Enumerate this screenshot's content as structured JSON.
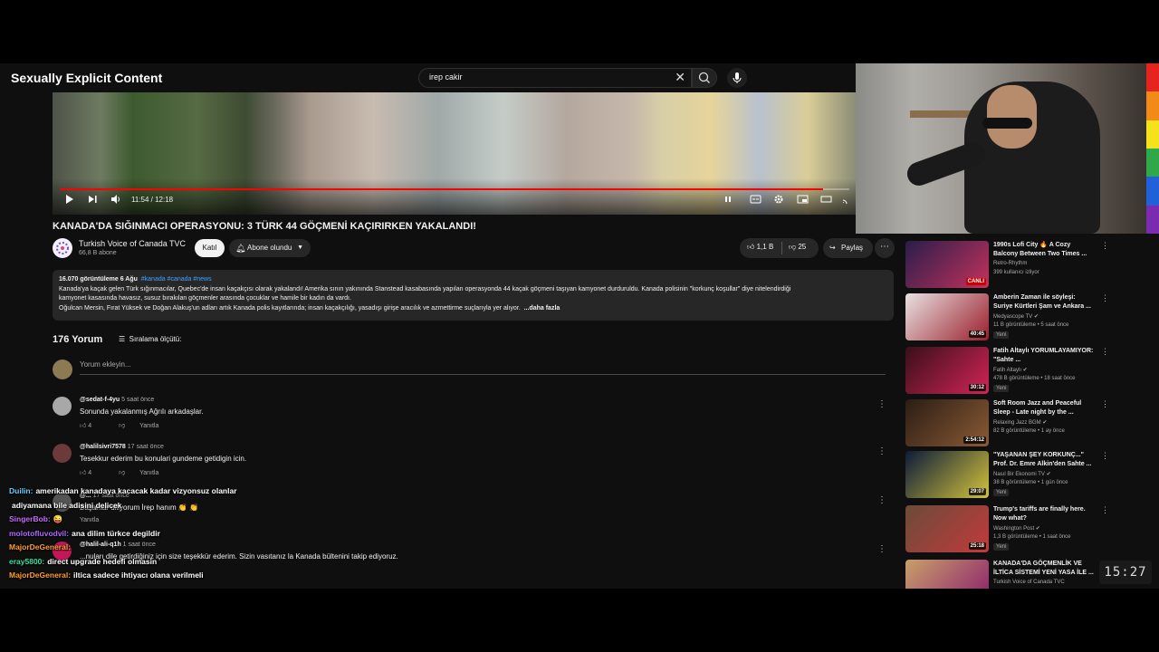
{
  "header": {
    "overlay_title": "Sexually Explicit Content",
    "search_value": "irep cakir"
  },
  "player": {
    "time": "11:54 / 12:18",
    "progress_fraction": 0.967
  },
  "video": {
    "title": "KANADA'DA SIĞINMACI OPERASYONU: 3 TÜRK 44 GÖÇMENİ KAÇIRIRKEN YAKALANDI!",
    "channel_name": "Turkish Voice of Canada TVC",
    "channel_subs": "66,8 B abone",
    "join_label": "Katıl",
    "subscribe_label": "Abone olundu",
    "like_count": "1,1 B",
    "dislike_count": "25",
    "share_label": "Paylaş"
  },
  "description": {
    "meta": "16.070 görüntüleme  6 Ağu",
    "tags": "#kanada #canada #news",
    "line1": "Kanada'ya kaçak gelen Türk sığınmacılar, Quebec'de insan kaçakçısı olarak yakalandı! Amerika sınırı yakınında Stanstead kasabasında yapılan operasyonda 44 kaçak göçmeni taşıyan kamyonet durduruldu. Kanada polisinin \"korkunç koşullar\" diye nitelendirdiği",
    "line2": "kamyonet kasasında havasız, susuz bırakılan göçmenler arasında çocuklar ve hamile bir kadın da vardı.",
    "line3": "Oğulcan Mersin, Fırat Yüksek ve Doğan Alakuş'un adları artık Kanada polis kayıtlarında; insan kaçakçılığı, yasadışı girişe aracılık ve azmettirme suçlarıyla yer alıyor.",
    "more": "...daha fazla"
  },
  "comments": {
    "count_label": "176 Yorum",
    "sort_label": "Sıralama ölçütü:",
    "input_placeholder": "Yorum ekleyin...",
    "items": [
      {
        "author": "@sedat-f-4yu",
        "time": "5 saat önce",
        "text": "Sonunda yakalanmış Ağrılı arkadaşlar.",
        "likes": "4",
        "reply": "Yanıtla"
      },
      {
        "author": "@halilsivri7578",
        "time": "17 saat önce",
        "text": "Tesekkur ederim bu konulari gundeme getidigin icin.",
        "likes": "4",
        "reply": "Yanıtla"
      },
      {
        "author": "@...",
        "time": "17 saat önce",
        "text": "Başarılar diliyorum İrep hanım 👏 👏",
        "likes": "",
        "reply": "Yanıtla"
      },
      {
        "author": "@halil-ali-q1h",
        "time": "1 saat önce",
        "text": "...nuları dile getirdiğiniz için size teşekkür ederim. Sizin vasıtanız la Kanada bültenini takip ediyoruz.",
        "likes": "",
        "reply": ""
      }
    ]
  },
  "recommended": [
    {
      "title": "1990s Lofi City 🔥 A Cozy Balcony Between Two Times ...",
      "channel": "Retro-Rhythm",
      "stats": "399 kullanıcı izliyor",
      "duration": "CANLI",
      "badge": "",
      "colors": [
        "#2a1d4a",
        "#c2325c"
      ]
    },
    {
      "title": "Amberin Zaman ile söyleşi: Suriye Kürtleri Şam ve Ankara ...",
      "channel": "Medyascope TV ✔",
      "stats": "11 B görüntüleme • 5 saat önce",
      "duration": "40:45",
      "badge": "Yeni",
      "colors": [
        "#e8e2e2",
        "#9a1e2b"
      ]
    },
    {
      "title": "Fatih Altaylı YORUMLAYAMIYOR: \"Sahte ...",
      "channel": "Fatih Altaylı ✔",
      "stats": "478 B görüntüleme • 18 saat önce",
      "duration": "30:12",
      "badge": "Yeni",
      "colors": [
        "#3a0f1a",
        "#d12456"
      ]
    },
    {
      "title": "Soft Room Jazz and Peaceful Sleep - Late night by the ...",
      "channel": "Relaxing Jazz BGM ✔",
      "stats": "82 B görüntüleme • 1 ay önce",
      "duration": "2:54:12",
      "badge": "",
      "colors": [
        "#2b1d14",
        "#8a5a35"
      ]
    },
    {
      "title": "\"YAŞANAN ŞEY KORKUNÇ...\" Prof. Dr. Emre Alkin'den Sahte ...",
      "channel": "Nasıl Bir Ekonomi TV ✔",
      "stats": "38 B görüntüleme • 1 gün önce",
      "duration": "29:07",
      "badge": "Yeni",
      "colors": [
        "#0c1b3a",
        "#d4c33a"
      ]
    },
    {
      "title": "Trump's tariffs are finally here. Now what?",
      "channel": "Washington Post ✔",
      "stats": "1,3 B görüntüleme • 1 saat önce",
      "duration": "25:18",
      "badge": "Yeni",
      "colors": [
        "#6b4b3a",
        "#c23a3a"
      ]
    },
    {
      "title": "KANADA'DA GÖÇMENLİK VE İLTİCA SİSTEMİ YENİ YASA İLE ...",
      "channel": "Turkish Voice of Canada TVC",
      "stats": "",
      "duration": "",
      "badge": "",
      "colors": [
        "#c9a06a",
        "#8a1b6d"
      ]
    }
  ],
  "chat": [
    {
      "user": "Duilin:",
      "user_color": "#6ccfff",
      "text": "amerikadan kanadaya kacacak kadar vizyonsuz olanlar"
    },
    {
      "user": "",
      "user_color": "#ffffff",
      "text": "adiyamana bile adisini delicek"
    },
    {
      "user": "SingerBob:",
      "user_color": "#c96bff",
      "text": "😜"
    },
    {
      "user": "molotofluvodvil:",
      "user_color": "#b267ff",
      "text": "ana dilim türkce degildir"
    },
    {
      "user": "MajorDeGeneral:",
      "user_color": "#ff9f2d",
      "text": ""
    },
    {
      "user": "eray5800:",
      "user_color": "#37e3a1",
      "text": "direct upgrade hedefi olmasin"
    },
    {
      "user": "MajorDeGeneral:",
      "user_color": "#ff9f2d",
      "text": "iltica sadece ihtiyacı olana verilmeli"
    }
  ],
  "clock": "15:27",
  "colors": {
    "accent_red": "#ff0000",
    "link_blue": "#3ea6ff",
    "bg": "#0f0f0f"
  }
}
